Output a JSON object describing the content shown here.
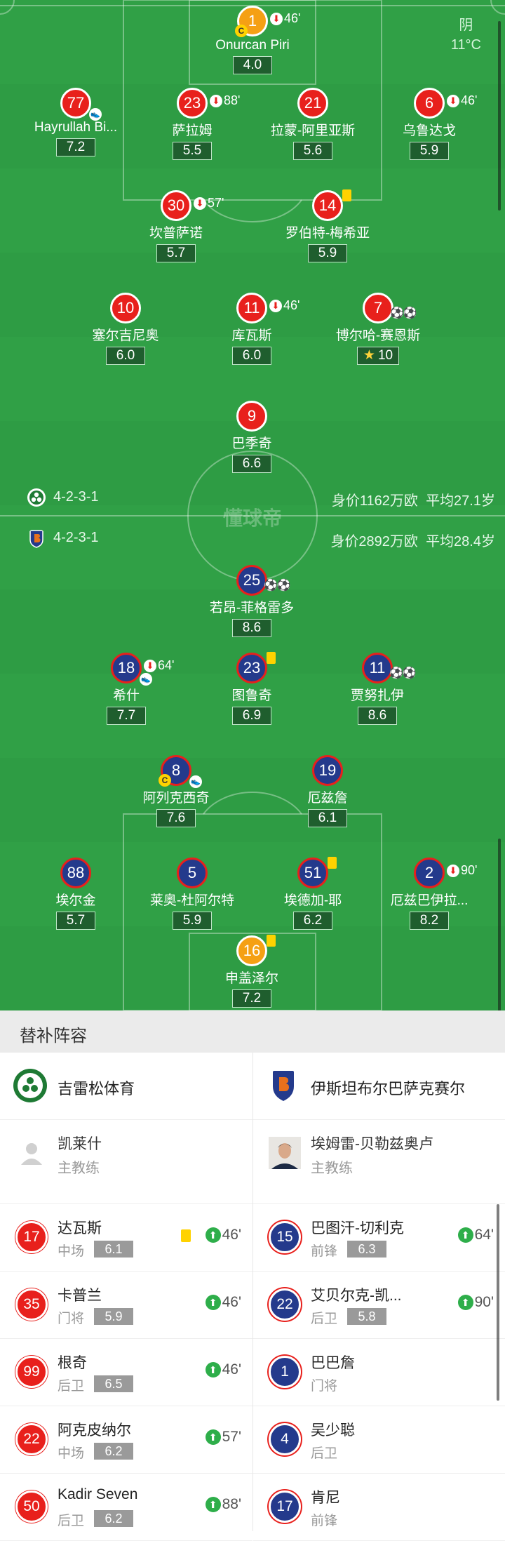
{
  "weather": {
    "condition": "阴",
    "temperature": "11°C"
  },
  "watermark": "懂球帝",
  "home_team": {
    "name": "吉雷松体育",
    "formation": "4-2-3-1",
    "value": "身价1162万欧",
    "avg_age": "平均27.1岁",
    "color": "#e8201c"
  },
  "away_team": {
    "name": "伊斯坦布尔巴萨克赛尔",
    "formation": "4-2-3-1",
    "value": "身价2892万欧",
    "avg_age": "平均28.4岁",
    "color": "#243a8c"
  },
  "home_players": [
    {
      "number": "1",
      "name": "Onurcan Piri",
      "rating": "4.0",
      "sub_min": "46'",
      "captain": "C"
    },
    {
      "number": "77",
      "name": "Hayrullah Bi...",
      "rating": "7.2",
      "assist": true
    },
    {
      "number": "23",
      "name": "萨拉姆",
      "rating": "5.5",
      "sub_min": "88'"
    },
    {
      "number": "21",
      "name": "拉蒙-阿里亚斯",
      "rating": "5.6"
    },
    {
      "number": "6",
      "name": "乌鲁达戈",
      "rating": "5.9",
      "sub_min": "46'"
    },
    {
      "number": "30",
      "name": "坎普萨诺",
      "rating": "5.7",
      "sub_min": "57'"
    },
    {
      "number": "14",
      "name": "罗伯特-梅希亚",
      "rating": "5.9",
      "yellow": true
    },
    {
      "number": "10",
      "name": "塞尔吉尼奥",
      "rating": "6.0"
    },
    {
      "number": "11",
      "name": "库瓦斯",
      "rating": "6.0",
      "sub_min": "46'"
    },
    {
      "number": "7",
      "name": "博尔哈-赛恩斯",
      "rating": "10",
      "goals": "⚽⚽"
    },
    {
      "number": "9",
      "name": "巴季奇",
      "rating": "6.6"
    }
  ],
  "away_players": [
    {
      "number": "25",
      "name": "若昂-菲格雷多",
      "rating": "8.6",
      "goals": "⚽⚽"
    },
    {
      "number": "18",
      "name": "希什",
      "rating": "7.7",
      "sub_min": "64'"
    },
    {
      "number": "23",
      "name": "图鲁奇",
      "rating": "6.9"
    },
    {
      "number": "11",
      "name": "贾努扎伊",
      "rating": "8.6",
      "goals": "⚽⚽"
    },
    {
      "number": "8",
      "name": "阿列克西奇",
      "rating": "7.6",
      "captain": "C"
    },
    {
      "number": "19",
      "name": "厄兹詹",
      "rating": "6.1"
    },
    {
      "number": "88",
      "name": "埃尔金",
      "rating": "5.7"
    },
    {
      "number": "5",
      "name": "莱奥-杜阿尔特",
      "rating": "5.9"
    },
    {
      "number": "51",
      "name": "埃德加-耶",
      "rating": "6.2"
    },
    {
      "number": "2",
      "name": "厄兹巴伊拉...",
      "rating": "8.2",
      "sub_min": "90'"
    },
    {
      "number": "16",
      "name": "申盖泽尔",
      "rating": "7.2"
    }
  ],
  "subs_title": "替补阵容",
  "home_coach": {
    "name": "凯莱什",
    "title": "主教练"
  },
  "away_coach": {
    "name": "埃姆雷-贝勒兹奥卢",
    "title": "主教练"
  },
  "home_subs": [
    {
      "number": "17",
      "name": "达瓦斯",
      "position": "中场",
      "rating": "6.1",
      "sub_in": "46'"
    },
    {
      "number": "35",
      "name": "卡普兰",
      "position": "门将",
      "rating": "5.9",
      "sub_in": "46'"
    },
    {
      "number": "99",
      "name": "根奇",
      "position": "后卫",
      "rating": "6.5",
      "sub_in": "46'"
    },
    {
      "number": "22",
      "name": "阿克皮纳尔",
      "position": "中场",
      "rating": "6.2",
      "sub_in": "57'"
    },
    {
      "number": "50",
      "name": "Kadir Seven",
      "position": "后卫",
      "rating": "6.2",
      "sub_in": "88'"
    }
  ],
  "away_subs": [
    {
      "number": "15",
      "name": "巴图汗-切利克",
      "position": "前锋",
      "rating": "6.3",
      "sub_in": "64'"
    },
    {
      "number": "22",
      "name": "艾贝尔克-凯...",
      "position": "后卫",
      "rating": "5.8",
      "sub_in": "90'"
    },
    {
      "number": "1",
      "name": "巴巴詹",
      "position": "门将"
    },
    {
      "number": "4",
      "name": "吴少聪",
      "position": "后卫"
    },
    {
      "number": "17",
      "name": "肯尼",
      "position": "前锋"
    }
  ]
}
